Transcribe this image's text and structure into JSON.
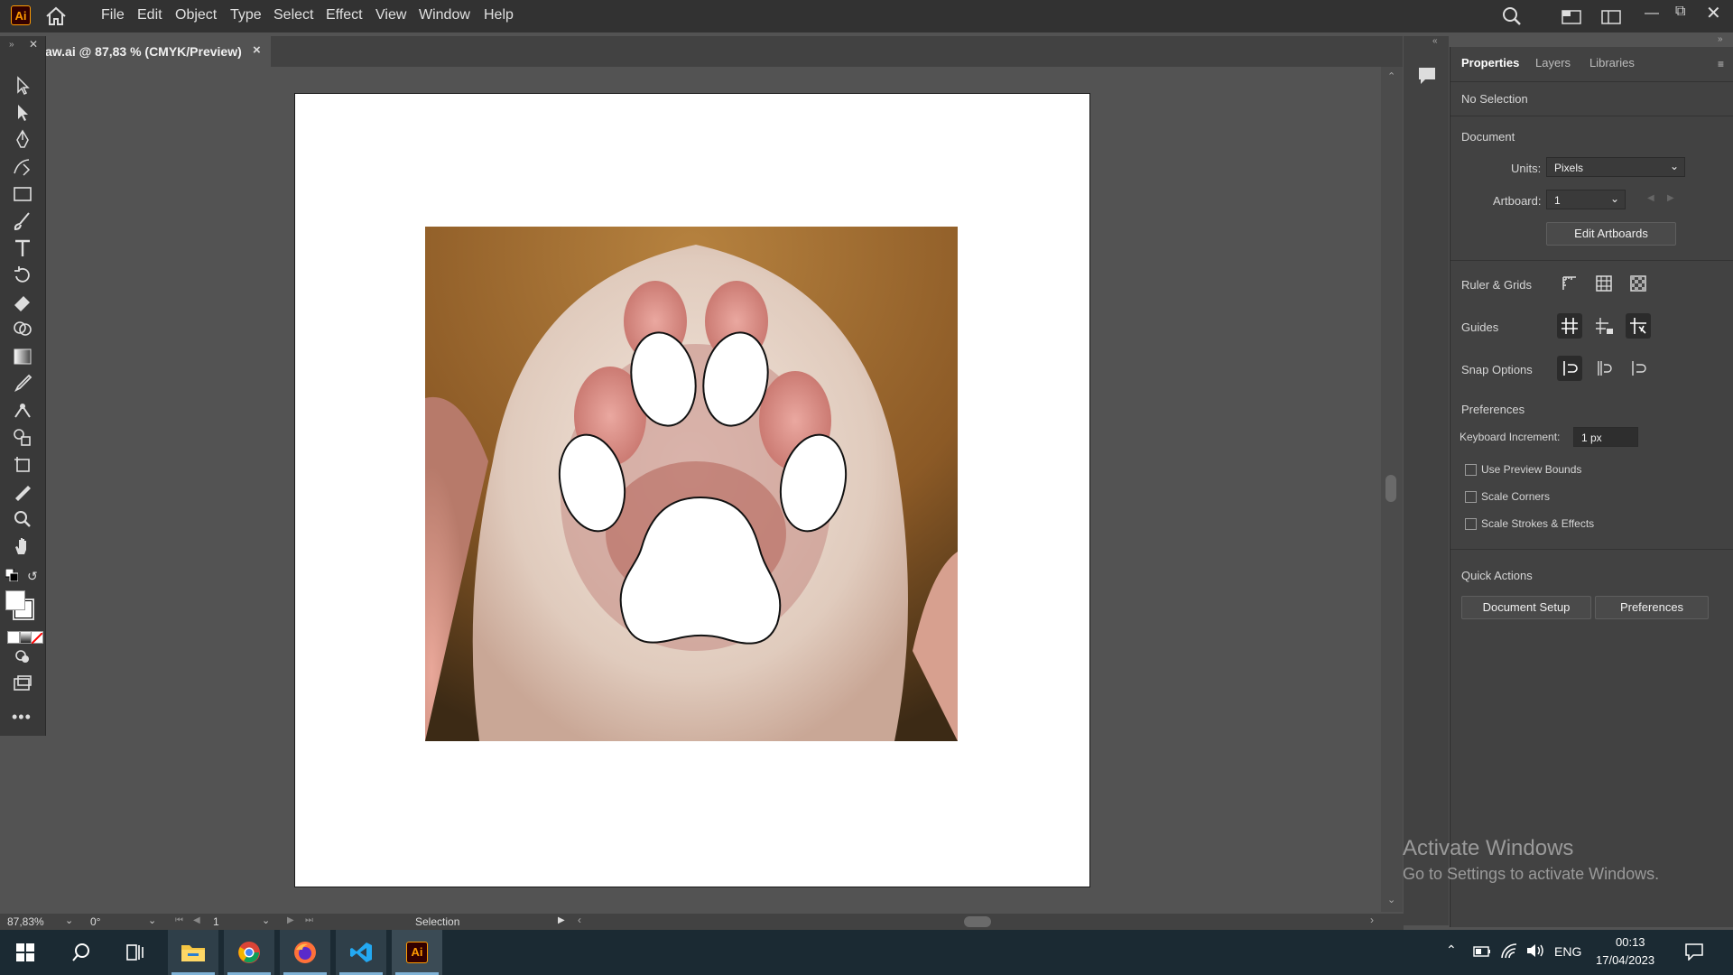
{
  "app": {
    "name": "Adobe Illustrator",
    "logo_text": "Ai"
  },
  "menu": [
    "File",
    "Edit",
    "Object",
    "Type",
    "Select",
    "Effect",
    "View",
    "Window",
    "Help"
  ],
  "document_tab": {
    "title": "aw.ai @ 87,83 % (CMYK/Preview)",
    "close": "×"
  },
  "panel": {
    "tabs": [
      "Properties",
      "Layers",
      "Libraries"
    ],
    "selection": "No Selection",
    "document_label": "Document",
    "units_label": "Units:",
    "units_value": "Pixels",
    "artboard_label": "Artboard:",
    "artboard_value": "1",
    "edit_artboards": "Edit Artboards",
    "ruler_grids": "Ruler & Grids",
    "guides": "Guides",
    "snap_options": "Snap Options",
    "preferences_label": "Preferences",
    "keyboard_increment_label": "Keyboard Increment:",
    "keyboard_increment_value": "1 px",
    "checkboxes": [
      {
        "label": "Use Preview Bounds",
        "checked": false
      },
      {
        "label": "Scale Corners",
        "checked": false
      },
      {
        "label": "Scale Strokes & Effects",
        "checked": false
      }
    ],
    "quick_actions": "Quick Actions",
    "document_setup": "Document Setup",
    "preferences_button": "Preferences"
  },
  "status": {
    "zoom": "87,83%",
    "rotation": "0°",
    "artboard": "1",
    "tool": "Selection"
  },
  "watermark": {
    "line1": "Activate Windows",
    "line2": "Go to Settings to activate Windows."
  },
  "taskbar": {
    "lang": "ENG",
    "time": "00:13",
    "date": "17/04/2023"
  },
  "colors": {
    "menubar": "#323232",
    "panel": "#424242",
    "canvas": "#535353",
    "accent": "#ff9a00",
    "taskbar": "#1b2a33"
  }
}
